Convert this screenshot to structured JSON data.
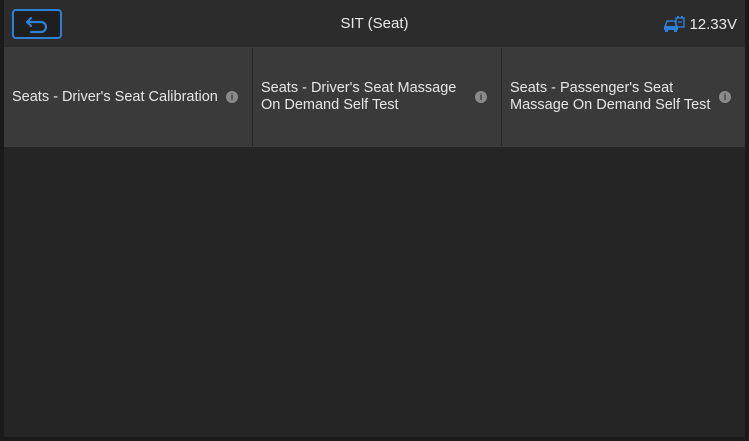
{
  "header": {
    "title": "SIT (Seat)",
    "voltage": "12.33V",
    "back_icon": "back-arrow-icon",
    "battery_icon": "car-battery-icon"
  },
  "functions": [
    {
      "label": "Seats - Driver's Seat Calibration"
    },
    {
      "label": "Seats - Driver's Seat Massage On Demand Self Test"
    },
    {
      "label": "Seats - Passenger's Seat Massage On Demand Self Test"
    }
  ],
  "colors": {
    "accent": "#2e7fd6",
    "cell_background": "#3a3a3a",
    "page_background": "#252525"
  }
}
